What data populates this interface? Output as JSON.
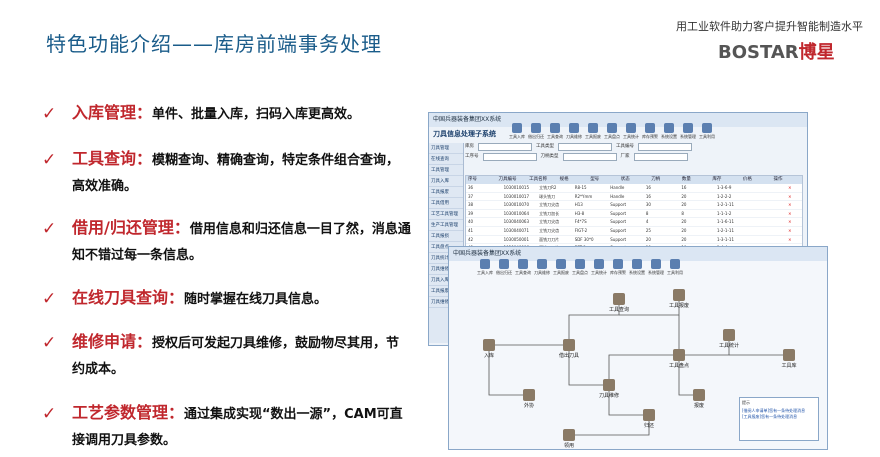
{
  "header": {
    "title": "特色功能介绍——库房前端事务处理",
    "tagline": "用工业软件助力客户提升智能制造水平",
    "logo_latin": "BOSTAR",
    "logo_cn": "博星"
  },
  "features": [
    {
      "name": "入库管理：",
      "desc": "单件、批量入库，扫码入库更高效。"
    },
    {
      "name": "工具查询：",
      "desc": "模糊查询、精确查询，特定条件组合查询，高效准确。"
    },
    {
      "name": "借用/归还管理：",
      "desc": "借用信息和归还信息一目了然，消息通知不错过每一条信息。"
    },
    {
      "name": "在线刀具查询：",
      "desc": "随时掌握在线刀具信息。"
    },
    {
      "name": "维修申请：",
      "desc": "授权后可发起刀具维修，鼓励物尽其用，节约成本。"
    },
    {
      "name": "工艺参数管理：",
      "desc": "通过集成实现“数出一源”，CAM可直接调用刀具参数。"
    }
  ],
  "screenshot1": {
    "window_title": "中国兵器装备集团XX系统",
    "system_title": "刀具信息处理子系统",
    "toolbar": [
      "工具入库",
      "借出归还",
      "工具查询",
      "刀具维修",
      "工具报废",
      "工具盘点",
      "工具统计",
      "库存预警",
      "系统设置",
      "系统管理",
      "工具利用"
    ],
    "sidebar": [
      "刀具管理",
      "在线查询",
      "工具管理",
      "刀具入库",
      "工具报废",
      "工具借用",
      "工艺工具管理",
      "生产工具管理",
      "工具报损",
      "工具盘点",
      "刀具统计",
      "刀具维修",
      "刀具入库",
      "工具报废",
      "刀具维修"
    ],
    "filters": [
      "库房",
      "工具类型",
      "工具编号",
      "工序号",
      "刀柄类型",
      "厂家"
    ],
    "columns": [
      "序号",
      "刀具编号",
      "工具名称",
      "规格",
      "型号",
      "状态",
      "刀柄",
      "数量",
      "库存",
      "价格",
      "操作"
    ],
    "rows": [
      [
        "36",
        "1030010015",
        "立铣刀R2",
        "R8-15",
        "Handle",
        "16",
        "16",
        "1-3-6-9",
        ""
      ],
      [
        "37",
        "1030010017",
        "球头铣刀",
        "R2*Ymm",
        "Handle",
        "16",
        "20",
        "1-2-2-2",
        ""
      ],
      [
        "38",
        "1030010070",
        "立铣刀尖齿",
        "H13",
        "Support",
        "30",
        "20",
        "1-2-1-11",
        ""
      ],
      [
        "39",
        "1030010064",
        "立铣刀加长",
        "H3-8",
        "Support",
        "8",
        "8",
        "1-1-1-2",
        ""
      ],
      [
        "40",
        "1030040063",
        "立铣刀尖齿",
        "F4*7S",
        "Support",
        "4",
        "20",
        "1-1-6-11",
        ""
      ],
      [
        "41",
        "1030040071",
        "立铣刀尖齿",
        "FIGT-2",
        "Support",
        "25",
        "20",
        "1-2-1-11",
        ""
      ],
      [
        "42",
        "1030050001",
        "面铣刀刀片",
        "SDF 30*0",
        "Support",
        "20",
        "20",
        "1-3-1-11",
        ""
      ],
      [
        "43",
        "1030040006",
        "面铣刀刀片",
        "BFT-8",
        "Support",
        "10",
        "10",
        "1-4-4",
        ""
      ],
      [
        "44",
        "1030050004",
        "面铣刀刀片",
        "BFT-8",
        "Support",
        "10",
        "20",
        "1-4-4",
        ""
      ]
    ]
  },
  "screenshot2": {
    "window_title": "中国兵器装备集团XX系统",
    "toolbar": [
      "工具入库",
      "借出归还",
      "工具查询",
      "刀具维修",
      "工具报废",
      "工具盘点",
      "工具统计",
      "库存预警",
      "系统设置",
      "系统管理",
      "工具利用"
    ],
    "nodes": [
      "入库",
      "借出刀具",
      "工具查询",
      "工具报废",
      "工具盘点",
      "工具统计",
      "刀具维修",
      "归还",
      "外协",
      "报废",
      "领用",
      "工具库"
    ],
    "popup_title": "提示",
    "popup_lines": [
      "[借阅人申请单]您有一条待处理消息",
      "[工具报废]您有一条待处理消息"
    ]
  },
  "colors": {
    "accent_red": "#c0272d",
    "title_blue": "#1a5c8a"
  }
}
